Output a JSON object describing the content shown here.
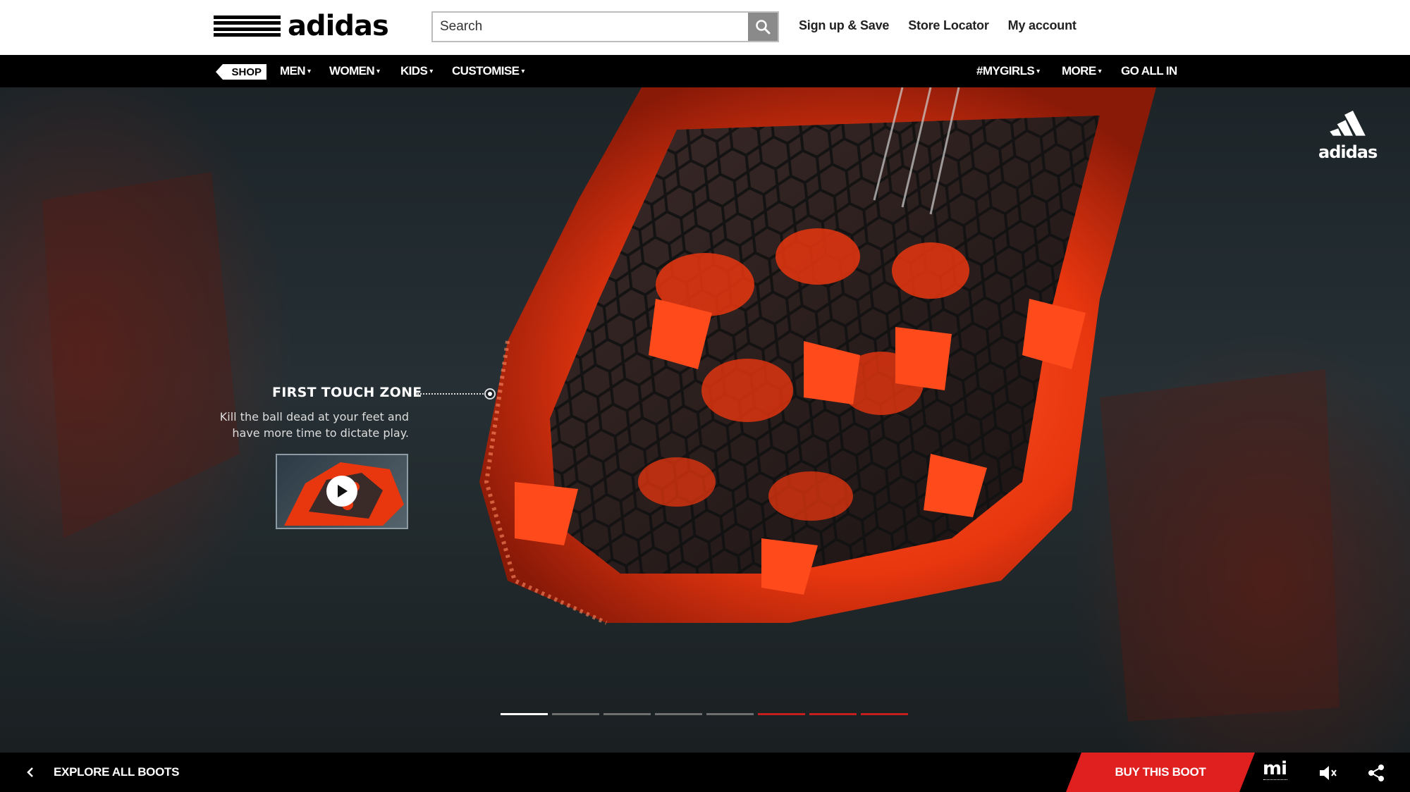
{
  "header": {
    "logo_text": "adidas",
    "search": {
      "placeholder": "Search"
    },
    "links": [
      "Sign up & Save",
      "Store Locator",
      "My account"
    ]
  },
  "nav": {
    "shop_label": "SHOP",
    "left_items": [
      "MEN",
      "WOMEN",
      "KIDS",
      "CUSTOMISE"
    ],
    "right_items": [
      "#MYGIRLS",
      "MORE",
      "GO ALL IN"
    ]
  },
  "hero": {
    "corner_logo_text": "adidas",
    "callout": {
      "title": "FIRST TOUCH ZONE",
      "description_line1": "Kill the ball dead at your feet and",
      "description_line2": "have more time to dictate play."
    },
    "pager": {
      "total": 8,
      "active_index": 0,
      "colors": {
        "active": "#ffffff",
        "inactive": "#6e6e6e",
        "upcoming": "#c41e1e"
      }
    }
  },
  "footer": {
    "explore_label": "EXPLORE ALL BOOTS",
    "buy_label": "BUY THIS BOOT",
    "mi_logo": "mi"
  },
  "colors": {
    "accent": "#e01f1f",
    "boot_red": "#ff3a12"
  }
}
